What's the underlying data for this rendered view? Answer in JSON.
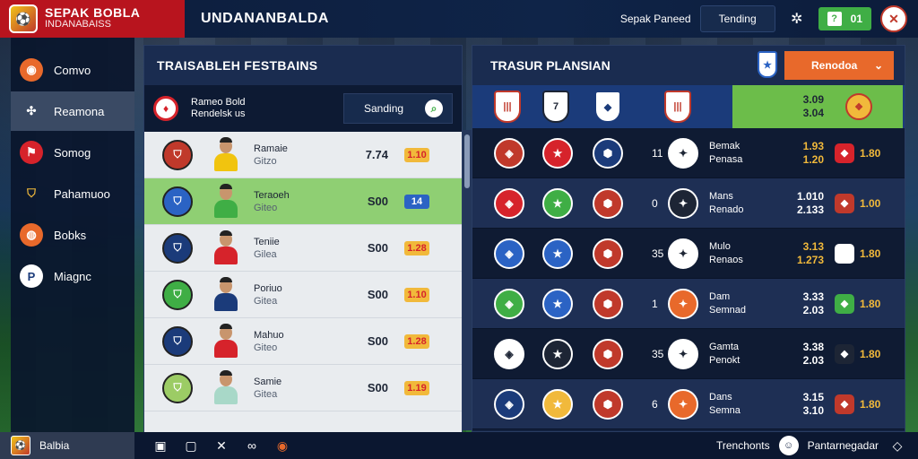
{
  "app": {
    "brand_title": "SEPAK BOBLA",
    "brand_subtitle": "INDANABAISS",
    "page_title": "UNDANANBALDA"
  },
  "topbar": {
    "link_text": "Sepak Paneed",
    "tab_label": "Tending",
    "score_label": "01"
  },
  "sidebar": {
    "items": [
      {
        "label": "Comvo",
        "icon": "soccer-ball-icon",
        "color": "#e8692b"
      },
      {
        "label": "Reamona",
        "icon": "tactics-icon",
        "color": "#ffffff"
      },
      {
        "label": "Somog",
        "icon": "boot-icon",
        "color": "#d6232b"
      },
      {
        "label": "Pahamuoo",
        "icon": "shield-icon",
        "color": "#f1b93b"
      },
      {
        "label": "Bobks",
        "icon": "ball-icon",
        "color": "#e8692b"
      },
      {
        "label": "Miagnc",
        "icon": "trophy-icon",
        "color": "#ffffff"
      }
    ],
    "active_index": 1
  },
  "left_panel": {
    "title": "TRAISABLEH FESTBAINS",
    "header_line1": "Rameo Bold",
    "header_line2": "Rendelsk us",
    "search_label": "Sanding",
    "rows": [
      {
        "name": "Ramaie",
        "sub": "Gitzo",
        "value": "7.74",
        "badge": "1.10",
        "crest_color": "#c0392b",
        "kit_color": "#f1c40f",
        "highlight": false
      },
      {
        "name": "Teraoeh",
        "sub": "Giteo",
        "value": "S00",
        "badge": "14",
        "crest_color": "#2b63c4",
        "kit_color": "#3fae45",
        "highlight": true
      },
      {
        "name": "Teniie",
        "sub": "Gilea",
        "value": "S00",
        "badge": "1.28",
        "crest_color": "#1b3b7a",
        "kit_color": "#d6232b",
        "highlight": false
      },
      {
        "name": "Poriuo",
        "sub": "Gitea",
        "value": "S00",
        "badge": "1.10",
        "crest_color": "#3fae45",
        "kit_color": "#1b3b7a",
        "highlight": false
      },
      {
        "name": "Mahuo",
        "sub": "Giteo",
        "value": "S00",
        "badge": "1.28",
        "crest_color": "#1b3b7a",
        "kit_color": "#d6232b",
        "highlight": false
      },
      {
        "name": "Samie",
        "sub": "Gitea",
        "value": "S00",
        "badge": "1.19",
        "crest_color": "#9ccc65",
        "kit_color": "#a8d8c8",
        "highlight": false
      }
    ]
  },
  "right_panel": {
    "title": "TRASUR PLANSIAN",
    "dropdown_label": "Renodoa",
    "header_stat_1": "3.09",
    "header_stat_2": "3.04",
    "rows": [
      {
        "num": "11",
        "name": "Bemak",
        "sub": "Penasa",
        "stat1": "1.93",
        "stat2": "1.20",
        "end": "1.80",
        "stat_color": "yellow"
      },
      {
        "num": "0",
        "name": "Mans",
        "sub": "Renado",
        "stat1": "1.010",
        "stat2": "2.133",
        "end": "1.00",
        "stat_color": "plain"
      },
      {
        "num": "35",
        "name": "Mulo",
        "sub": "Renaos",
        "stat1": "3.13",
        "stat2": "1.273",
        "end": "1.80",
        "stat_color": "yellow"
      },
      {
        "num": "1",
        "name": "Dam",
        "sub": "Semnad",
        "stat1": "3.33",
        "stat2": "2.03",
        "end": "1.80",
        "stat_color": "plain"
      },
      {
        "num": "35",
        "name": "Gamta",
        "sub": "Penokt",
        "stat1": "3.38",
        "stat2": "2.03",
        "end": "1.80",
        "stat_color": "plain"
      },
      {
        "num": "6",
        "name": "Dans",
        "sub": "Semna",
        "stat1": "3.15",
        "stat2": "3.10",
        "end": "1.80",
        "stat_color": "plain"
      }
    ]
  },
  "bottombar": {
    "team_label": "Balbia",
    "right_text": "Trenchonts",
    "user_text": "Pantarnegadar"
  }
}
